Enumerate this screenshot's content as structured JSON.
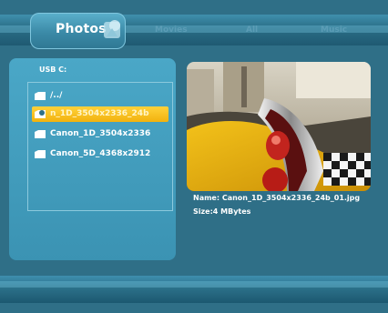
{
  "tabs": [
    {
      "label": "Photos",
      "active": true
    },
    {
      "label": "Movies",
      "active": false
    },
    {
      "label": "All",
      "active": false
    },
    {
      "label": "Music",
      "active": false
    }
  ],
  "browser": {
    "path": "USB   C:",
    "items": [
      {
        "label": "/../",
        "selected": false
      },
      {
        "label": "n_1D_3504x2336_24b",
        "selected": true
      },
      {
        "label": "Canon_1D_3504x2336",
        "selected": false
      },
      {
        "label": "Canon_5D_4368x2912",
        "selected": false
      }
    ]
  },
  "file_info": {
    "name": "Name: Canon_1D_3504x2336_24b_01.jpg",
    "size": "Size:4 MBytes"
  },
  "colors": {
    "background": "#2f6f87",
    "panel": "#3b93b3",
    "selection": "#f2b20e"
  }
}
